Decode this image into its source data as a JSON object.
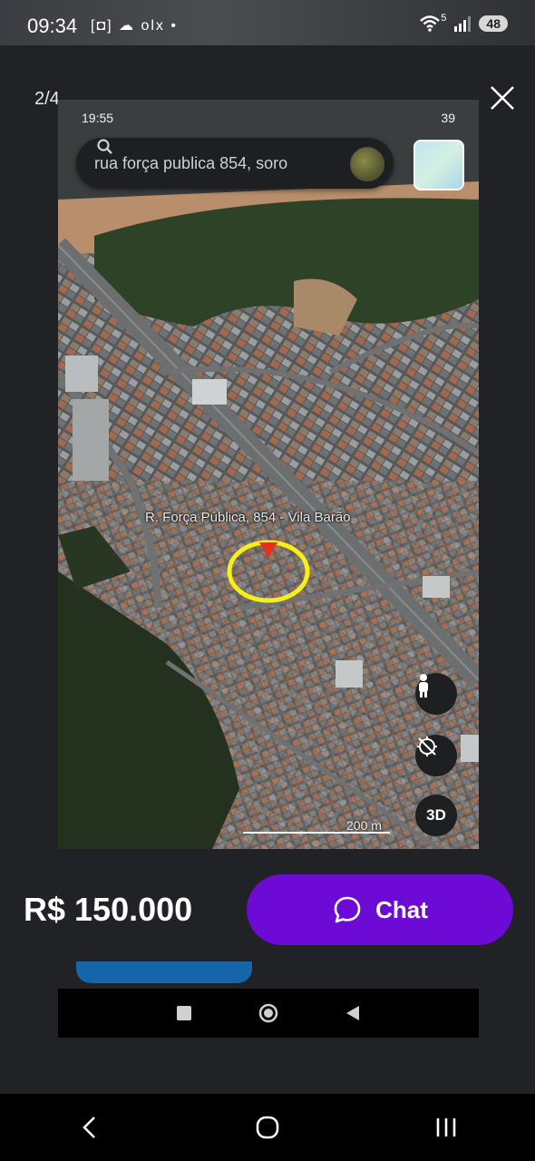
{
  "status_bar": {
    "time": "09:34",
    "notif_icons": "[◘] ☁ olx •",
    "network": "5",
    "battery": "48"
  },
  "viewer": {
    "counter": "2/4"
  },
  "screenshot": {
    "time": "19:55",
    "battery": "39",
    "search_text": "rua força publica 854, soro",
    "map_label": "R. Força Pública, 854 - Vila Barão",
    "scale": "200 m",
    "btn_3d": "3D"
  },
  "listing": {
    "price": "R$ 150.000",
    "chat_label": "Chat",
    "accent": "#6e0ad6"
  },
  "icons": [
    "close-icon",
    "search-icon",
    "pegman-icon",
    "compass-icon",
    "chat-bubble-icon",
    "back-icon",
    "home-icon",
    "recents-icon"
  ]
}
